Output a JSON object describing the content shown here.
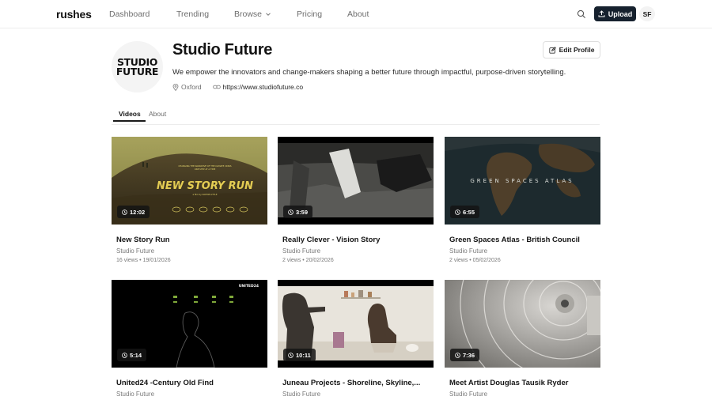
{
  "nav": {
    "logo": "rushes",
    "links": [
      "Dashboard",
      "Trending",
      "Browse",
      "Pricing",
      "About"
    ],
    "upload_label": "Upload",
    "avatar_initials": "SF"
  },
  "profile": {
    "avatar_line1": "STUDIO",
    "avatar_line2": "FUTURE",
    "name": "Studio Future",
    "bio": "We empower the innovators and change-makers shaping a better future through impactful, purpose-driven storytelling.",
    "location": "Oxford",
    "website": "https://www.studiofuture.co",
    "edit_label": "Edit Profile"
  },
  "tabs": [
    "Videos",
    "About"
  ],
  "videos": [
    {
      "title": "New Story Run",
      "channel": "Studio Future",
      "stats": "16 views • 19/01/2026",
      "duration": "12:02",
      "overlay_title": "NEW STORY RUN",
      "overlay_tag": "CHANGING THE NARRATIVE OF THE CLIMATE CRISIS",
      "overlay_tag2": "ONE STEP AT A TIME",
      "overlay_credit": "a film by SOPHIE LITTLE"
    },
    {
      "title": "Really Clever - Vision Story",
      "channel": "Studio Future",
      "stats": "2 views • 20/02/2026",
      "duration": "3:59"
    },
    {
      "title": "Green Spaces Atlas - British Council",
      "channel": "Studio Future",
      "stats": "2 views • 05/02/2026",
      "duration": "6:55",
      "overlay_title": "GREEN SPACES ATLAS"
    },
    {
      "title": "United24 -Century Old Find",
      "channel": "Studio Future",
      "stats": "",
      "duration": "5:14",
      "overlay_title": "UNITED24"
    },
    {
      "title": "Juneau Projects - Shoreline, Skyline,...",
      "channel": "Studio Future",
      "stats": "",
      "duration": "10:11"
    },
    {
      "title": "Meet Artist Douglas Tausik Ryder",
      "channel": "Studio Future",
      "stats": "",
      "duration": "7:36"
    }
  ],
  "colors": {
    "primary_button": "#16212e",
    "muted_text": "#6e6e6e",
    "border": "#ececec"
  }
}
